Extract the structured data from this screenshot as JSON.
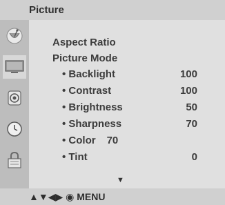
{
  "header": {
    "title": "Picture"
  },
  "sidebar": {
    "icons": [
      "satellite-dish-icon",
      "tv-screen-icon",
      "speaker-icon",
      "clock-icon",
      "lock-icon"
    ],
    "active": "tv-screen-icon"
  },
  "menu": {
    "items": [
      {
        "label": "Aspect Ratio",
        "value": ""
      },
      {
        "label": "Picture Mode",
        "value": ""
      },
      {
        "label": "• Backlight",
        "value": "100"
      },
      {
        "label": "• Contrast",
        "value": "100"
      },
      {
        "label": "• Brightness",
        "value": "50"
      },
      {
        "label": "• Sharpness",
        "value": "70"
      },
      {
        "label": "• Color",
        "value": "70"
      },
      {
        "label": "• Tint",
        "value": "0"
      }
    ],
    "more_indicator": "▼"
  },
  "footer": {
    "hint": "▲▼◀▶ ◉ MENU"
  },
  "colors": {
    "header_bg": "#d0d0d0",
    "sidebar_bg": "#bdbdbd",
    "panel_bg": "#e0e0e0",
    "text": "#3c3c3c"
  }
}
